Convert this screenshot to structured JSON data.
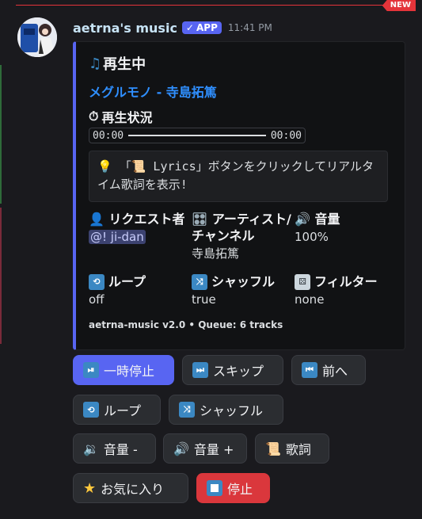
{
  "new_badge": "NEW",
  "message": {
    "author": "aetrna's music",
    "app_badge": "APP",
    "time": "11:41 PM"
  },
  "embed": {
    "title": "再生中",
    "track": "メグルモノ - 寺島拓篤",
    "status_title": "再生状況",
    "progress_start": "00:00",
    "progress_end": "00:00",
    "hint": "「📜 Lyrics」ボタンをクリックしてリアルタイム歌詞を表示!",
    "fields": {
      "requester_label": "リクエスト者",
      "requester_value": "@! ji-dan",
      "artist_label": "アーティスト/チャンネル",
      "artist_value": "寺島拓篤",
      "volume_label": "音量",
      "volume_value": "100%",
      "loop_label": "ループ",
      "loop_value": "off",
      "shuffle_label": "シャッフル",
      "shuffle_value": "true",
      "filter_label": "フィルター",
      "filter_value": "none"
    },
    "footer": "aetrna-music v2.0 • Queue: 6 tracks"
  },
  "buttons": {
    "pause": "一時停止",
    "skip": "スキップ",
    "prev": "前へ",
    "loop": "ループ",
    "shuffle": "シャッフル",
    "vol_down": "音量 -",
    "vol_up": "音量 +",
    "lyrics": "歌詞",
    "favorite": "お気に入り",
    "stop": "停止"
  },
  "colors": {
    "accent": "#5865f2",
    "danger": "#da373c",
    "link": "#2f8fff"
  }
}
